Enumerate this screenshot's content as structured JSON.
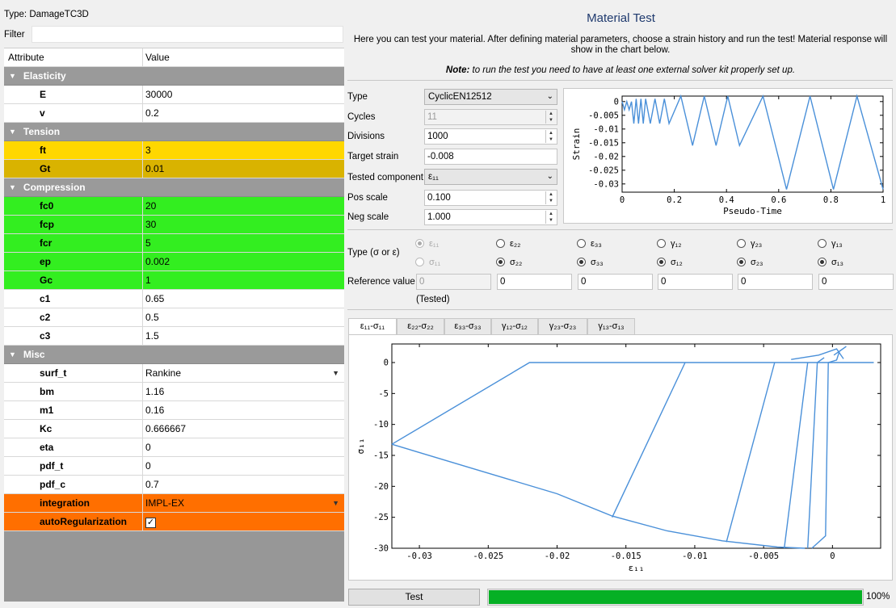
{
  "left": {
    "type_line": "Type:  DamageTC3D",
    "filter_label": "Filter",
    "filter_value": "",
    "col_attribute": "Attribute",
    "col_value": "Value",
    "groups": [
      {
        "name": "Elasticity",
        "rows": [
          {
            "attr": "E",
            "value": "30000",
            "color": "#ffffff"
          },
          {
            "attr": "v",
            "value": "0.2",
            "color": "#ffffff"
          }
        ]
      },
      {
        "name": "Tension",
        "rows": [
          {
            "attr": "ft",
            "value": "3",
            "color": "#ffd700"
          },
          {
            "attr": "Gt",
            "value": "0.01",
            "color": "#d9b300"
          }
        ]
      },
      {
        "name": "Compression",
        "rows": [
          {
            "attr": "fc0",
            "value": "20",
            "color": "#33ee20"
          },
          {
            "attr": "fcp",
            "value": "30",
            "color": "#33ee20"
          },
          {
            "attr": "fcr",
            "value": "5",
            "color": "#33ee20"
          },
          {
            "attr": "ep",
            "value": "0.002",
            "color": "#33ee20"
          },
          {
            "attr": "Gc",
            "value": "1",
            "color": "#33ee20"
          },
          {
            "attr": "c1",
            "value": "0.65",
            "color": "#ffffff"
          },
          {
            "attr": "c2",
            "value": "0.5",
            "color": "#ffffff"
          },
          {
            "attr": "c3",
            "value": "1.5",
            "color": "#ffffff"
          }
        ]
      },
      {
        "name": "Misc",
        "rows": [
          {
            "attr": "surf_t",
            "value": "Rankine",
            "color": "#ffffff",
            "dropdown": true
          },
          {
            "attr": "bm",
            "value": "1.16",
            "color": "#ffffff"
          },
          {
            "attr": "m1",
            "value": "0.16",
            "color": "#ffffff"
          },
          {
            "attr": "Kc",
            "value": "0.666667",
            "color": "#ffffff"
          },
          {
            "attr": "eta",
            "value": "0",
            "color": "#ffffff"
          },
          {
            "attr": "pdf_t",
            "value": "0",
            "color": "#ffffff"
          },
          {
            "attr": "pdf_c",
            "value": "0.7",
            "color": "#ffffff"
          },
          {
            "attr": "integration",
            "value": "IMPL-EX",
            "color": "#ff6f00",
            "dropdown": true
          },
          {
            "attr": "autoRegularization",
            "value": "",
            "color": "#ff6f00",
            "checkbox": true,
            "checked": true
          }
        ]
      }
    ]
  },
  "right": {
    "title": "Material Test",
    "description": "Here you can test your material. After defining material parameters, choose a strain history and run the test! Material response will show in the chart below.",
    "note_bold": "Note:",
    "note_text": " to run the test you need to have at least one external solver kit properly set up.",
    "form": {
      "type_label": "Type",
      "type_value": "CyclicEN12512",
      "cycles_label": "Cycles",
      "cycles_value": "11",
      "divisions_label": "Divisions",
      "divisions_value": "1000",
      "target_strain_label": "Target strain",
      "target_strain_value": "-0.008",
      "tested_component_label": "Tested component",
      "tested_component_value": "ε₁₁",
      "pos_scale_label": "Pos scale",
      "pos_scale_value": "0.100",
      "neg_scale_label": "Neg scale",
      "neg_scale_value": "1.000"
    },
    "type_sigma_label": "Type (σ or ε)",
    "components": [
      {
        "eps": "ε₁₁",
        "sig": "σ₁₁",
        "sel": "eps",
        "disabled": true,
        "ref": "0"
      },
      {
        "eps": "ε₂₂",
        "sig": "σ₂₂",
        "sel": "sig",
        "disabled": false,
        "ref": "0"
      },
      {
        "eps": "ε₃₃",
        "sig": "σ₃₃",
        "sel": "sig",
        "disabled": false,
        "ref": "0"
      },
      {
        "eps": "γ₁₂",
        "sig": "σ₁₂",
        "sel": "sig",
        "disabled": false,
        "ref": "0"
      },
      {
        "eps": "γ₂₃",
        "sig": "σ₂₃",
        "sel": "sig",
        "disabled": false,
        "ref": "0"
      },
      {
        "eps": "γ₁₃",
        "sig": "σ₁₃",
        "sel": "sig",
        "disabled": false,
        "ref": "0"
      }
    ],
    "reference_value_label": "Reference value",
    "tested_label": "(Tested)",
    "tabs": [
      "ε₁₁-σ₁₁",
      "ε₂₂-σ₂₂",
      "ε₃₃-σ₃₃",
      "γ₁₂-σ₁₂",
      "γ₂₃-σ₂₃",
      "γ₁₃-σ₁₃"
    ],
    "active_tab": 0,
    "test_button": "Test",
    "progress": 1.0,
    "progress_label": "100%"
  },
  "chart_data": [
    {
      "type": "line",
      "title": "",
      "xlabel": "Pseudo-Time",
      "ylabel": "Strain",
      "xlim": [
        0,
        1
      ],
      "ylim": [
        -0.033,
        0.002
      ],
      "xticks": [
        "0",
        "0.2",
        "0.4",
        "0.6",
        "0.8",
        "1"
      ],
      "yticks": [
        "0",
        "-0.005",
        "-0.01",
        "-0.015",
        "-0.02",
        "-0.025",
        "-0.03"
      ],
      "series": [
        {
          "x": [
            0,
            0.009,
            0.018,
            0.027,
            0.036,
            0.045,
            0.054,
            0.063,
            0.072,
            0.081,
            0.09,
            0.108,
            0.126,
            0.144,
            0.162,
            0.18,
            0.225,
            0.27,
            0.315,
            0.36,
            0.405,
            0.45,
            0.54,
            0.63,
            0.72,
            0.81,
            0.9,
            1.0
          ],
          "y": [
            0,
            -0.003,
            0,
            -0.003,
            0,
            -0.008,
            0.001,
            -0.008,
            0.001,
            -0.008,
            0.001,
            -0.008,
            0.001,
            -0.008,
            0.001,
            -0.008,
            0.002,
            -0.016,
            0.002,
            -0.016,
            0.002,
            -0.016,
            0.002,
            -0.032,
            0.002,
            -0.032,
            0.002,
            -0.032
          ]
        }
      ],
      "color": "#4a90d9"
    },
    {
      "type": "line",
      "title": "",
      "xlabel": "ε₁₁",
      "ylabel": "σ₁₁",
      "xlim": [
        -0.032,
        0.0035
      ],
      "ylim": [
        -30,
        3
      ],
      "xticks": [
        "-0.03",
        "-0.025",
        "-0.02",
        "-0.015",
        "-0.01",
        "-0.005",
        "0"
      ],
      "yticks": [
        "0",
        "-5",
        "-10",
        "-15",
        "-20",
        "-25",
        "-30"
      ],
      "series": [
        {
          "x": [
            -0.032,
            -0.022,
            0.003
          ],
          "y": [
            -13.2,
            0,
            0
          ]
        },
        {
          "x": [
            -0.032,
            -0.026,
            -0.02,
            -0.016,
            -0.012,
            -0.008,
            -0.004,
            -0.002
          ],
          "y": [
            -13.2,
            -17.2,
            -21.2,
            -24.8,
            -27.2,
            -28.8,
            -29.8,
            -30.0
          ]
        },
        {
          "x": [
            -0.016,
            -0.0107
          ],
          "y": [
            -25.0,
            0
          ]
        },
        {
          "x": [
            -0.0077,
            -0.0042
          ],
          "y": [
            -29.0,
            0
          ]
        },
        {
          "x": [
            -0.0035,
            -0.0018
          ],
          "y": [
            -30.0,
            0
          ]
        },
        {
          "x": [
            -0.0018,
            -0.0011,
            -0.0006
          ],
          "y": [
            -30.0,
            0,
            0.8
          ]
        },
        {
          "x": [
            -0.0015,
            -0.0005,
            -0.0003,
            0.0003,
            0.0005,
            0.001,
            0.0001
          ],
          "y": [
            -30.0,
            -28.0,
            0,
            0.4,
            1.8,
            2.6,
            1.2
          ]
        },
        {
          "x": [
            -0.003,
            -0.001,
            0.0003,
            0.0008
          ],
          "y": [
            0.5,
            1.2,
            2.2,
            0.6
          ]
        }
      ],
      "color": "#4a90d9"
    }
  ]
}
